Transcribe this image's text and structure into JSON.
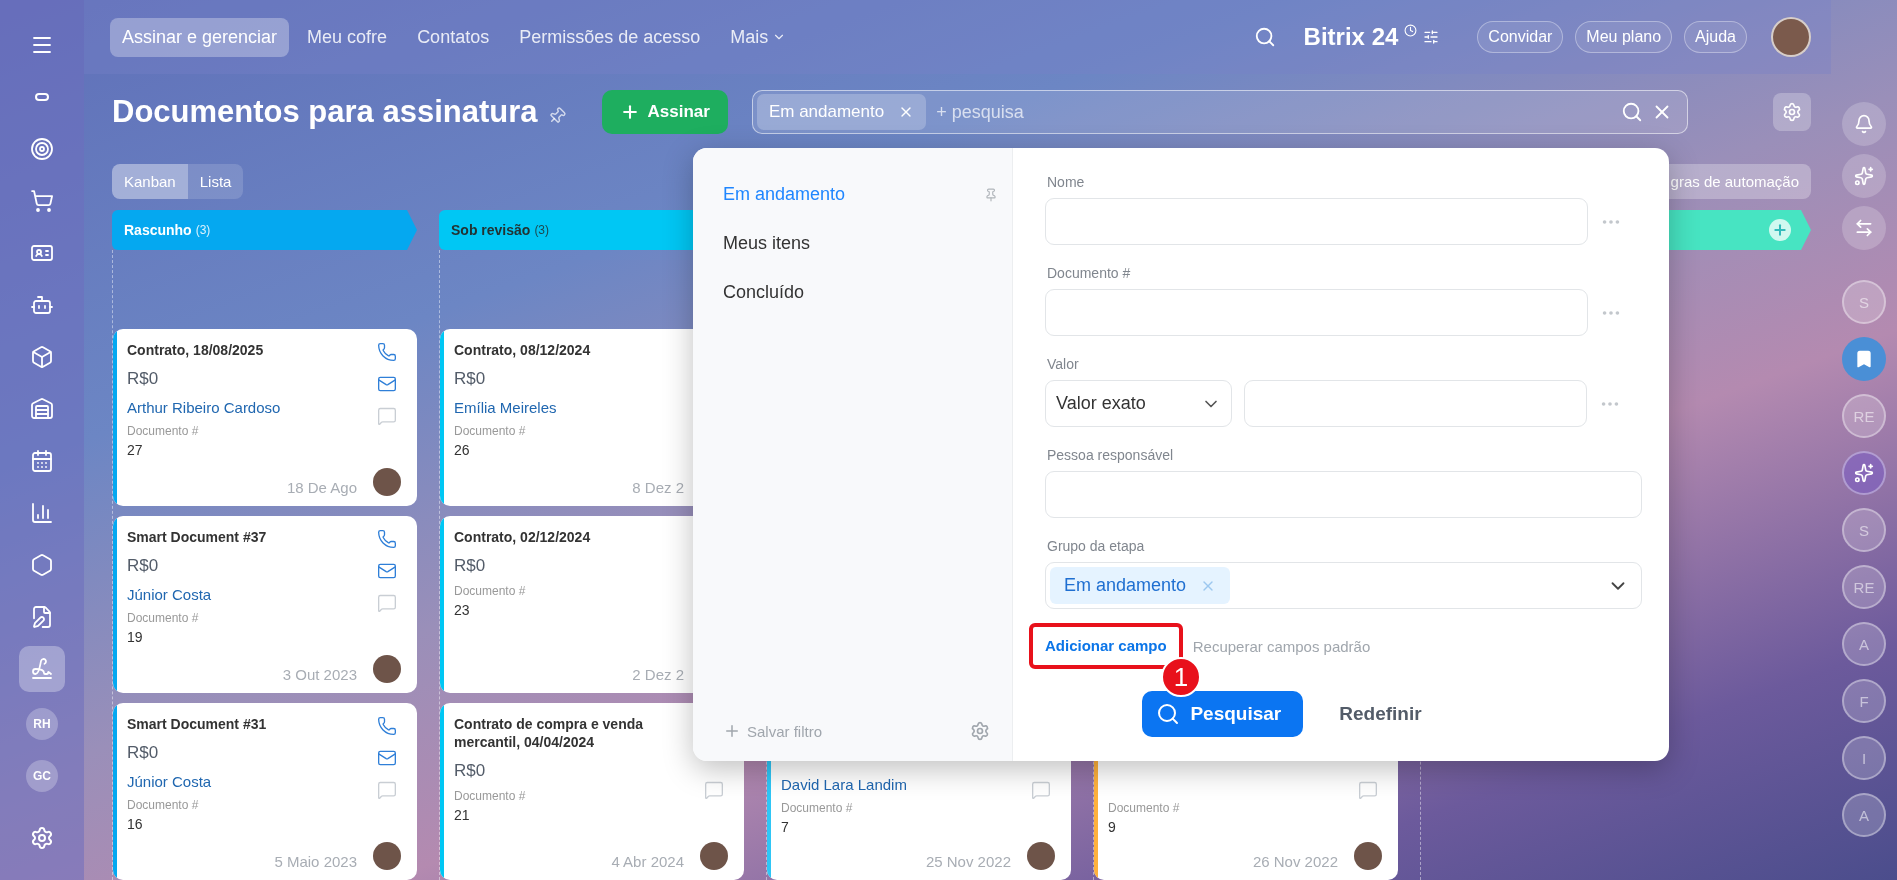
{
  "sidebar": {
    "items": [
      {
        "selected": false
      },
      {
        "selected": false
      },
      {
        "selected": false
      },
      {
        "selected": false
      },
      {
        "selected": false
      },
      {
        "selected": false
      },
      {
        "selected": false
      },
      {
        "selected": false
      },
      {
        "selected": false
      },
      {
        "selected": false
      },
      {
        "selected": false
      },
      {
        "selected": false
      },
      {
        "selected": true
      }
    ],
    "avatars": [
      {
        "label": "RH"
      },
      {
        "label": "GC"
      }
    ]
  },
  "top_nav": {
    "items": [
      {
        "label": "Assinar e gerenciar",
        "selected": true
      },
      {
        "label": "Meu cofre",
        "selected": false
      },
      {
        "label": "Contatos",
        "selected": false
      },
      {
        "label": "Permissões de acesso",
        "selected": false
      },
      {
        "label": "Mais",
        "selected": false
      }
    ],
    "logo": "Bitrix 24",
    "buttons": [
      "Convidar",
      "Meu plano",
      "Ajuda"
    ]
  },
  "page": {
    "title": "Documentos para assinatura",
    "add_button": "Assinar",
    "search": {
      "tag": "Em andamento",
      "placeholder": "+ pesquisa"
    },
    "views": [
      {
        "label": "Kanban",
        "selected": true
      },
      {
        "label": "Lista",
        "selected": false
      }
    ],
    "automation_button": "gras de automação"
  },
  "columns": [
    {
      "title": "Rascunho",
      "count": "(3)",
      "color": "#05a8f0",
      "cards": [
        {
          "title": "Contrato, 18/08/2025",
          "price": "R$0",
          "person": "Arthur Ribeiro Cardoso",
          "doc_label": "Documento #",
          "doc_number": "27",
          "date": "18 De Ago",
          "actions": [
            {
              "kind": "phone"
            },
            {
              "kind": "mail"
            },
            {
              "kind": "comment"
            }
          ]
        },
        {
          "title": "Smart Document #37",
          "price": "R$0",
          "person": "Júnior Costa",
          "doc_label": "Documento #",
          "doc_number": "19",
          "date": "3 Out 2023",
          "actions": [
            {
              "kind": "phone"
            },
            {
              "kind": "mail"
            },
            {
              "kind": "comment"
            }
          ]
        },
        {
          "title": "Smart Document #31",
          "price": "R$0",
          "person": "Júnior Costa",
          "doc_label": "Documento #",
          "doc_number": "16",
          "date": "5 Maio 2023",
          "actions": [
            {
              "kind": "phone"
            },
            {
              "kind": "mail"
            },
            {
              "kind": "comment"
            }
          ]
        }
      ]
    },
    {
      "title": "Sob revisão",
      "count": "(3)",
      "color": "#00c7f4",
      "cards": [
        {
          "title": "Contrato, 08/12/2024",
          "price": "R$0",
          "person": "Emília Meireles",
          "doc_label": "Documento #",
          "doc_number": "26",
          "date": "8 Dez 2"
        },
        {
          "title": "Contrato, 02/12/2024",
          "price": "R$0",
          "doc_label": "Documento #",
          "doc_number": "23",
          "date": "2 Dez 2"
        },
        {
          "title": "Contrato de compra e venda mercantil, 04/04/2024",
          "price": "R$0",
          "doc_label": "Documento #",
          "doc_number": "21",
          "date": "4 Abr 2024",
          "actions": [
            {
              "kind": "comment"
            }
          ]
        }
      ]
    },
    {
      "color": "#2fc6f6",
      "cards": [
        {
          "person": "David Lara Landim",
          "doc_label": "Documento #",
          "doc_number": "7",
          "date": "25 Nov 2022",
          "actions": [
            {
              "kind": "comment"
            }
          ]
        }
      ]
    },
    {
      "color": "#ffb13d",
      "cards": [
        {
          "doc_label": "Documento #",
          "doc_number": "9",
          "date": "26 Nov 2022",
          "actions": [
            {
              "kind": "comment"
            }
          ]
        }
      ]
    },
    {
      "color": "#47e4c2"
    }
  ],
  "filter": {
    "presets": [
      {
        "label": "Em andamento",
        "selected": true
      },
      {
        "label": "Meus itens",
        "selected": false
      },
      {
        "label": "Concluído",
        "selected": false
      }
    ],
    "save_filter": "Salvar filtro",
    "fields": [
      {
        "kind": "text",
        "label": "Nome"
      },
      {
        "kind": "text",
        "label": "Documento #"
      },
      {
        "kind": "range",
        "label": "Valor",
        "select": "Valor exato"
      },
      {
        "kind": "person",
        "label": "Pessoa responsável"
      },
      {
        "kind": "tags",
        "label": "Grupo da etapa",
        "tags": [
          "Em andamento"
        ]
      }
    ],
    "add_field": "Adicionar campo",
    "restore_fields": "Recuperar campos padrão",
    "annotation": "1",
    "search_button": "Pesquisar",
    "reset_button": "Redefinir"
  },
  "right_bar": {
    "contacts": [
      {
        "kind": "initials",
        "label": "S"
      },
      {
        "kind": "bookmark"
      },
      {
        "kind": "initials",
        "label": "RE"
      },
      {
        "kind": "swirl"
      },
      {
        "kind": "initials",
        "label": "S"
      },
      {
        "kind": "initials",
        "label": "RE"
      },
      {
        "kind": "initials",
        "label": "A"
      },
      {
        "kind": "initials",
        "label": "F"
      },
      {
        "kind": "initials",
        "label": "I"
      },
      {
        "kind": "initials",
        "label": "A"
      }
    ]
  }
}
